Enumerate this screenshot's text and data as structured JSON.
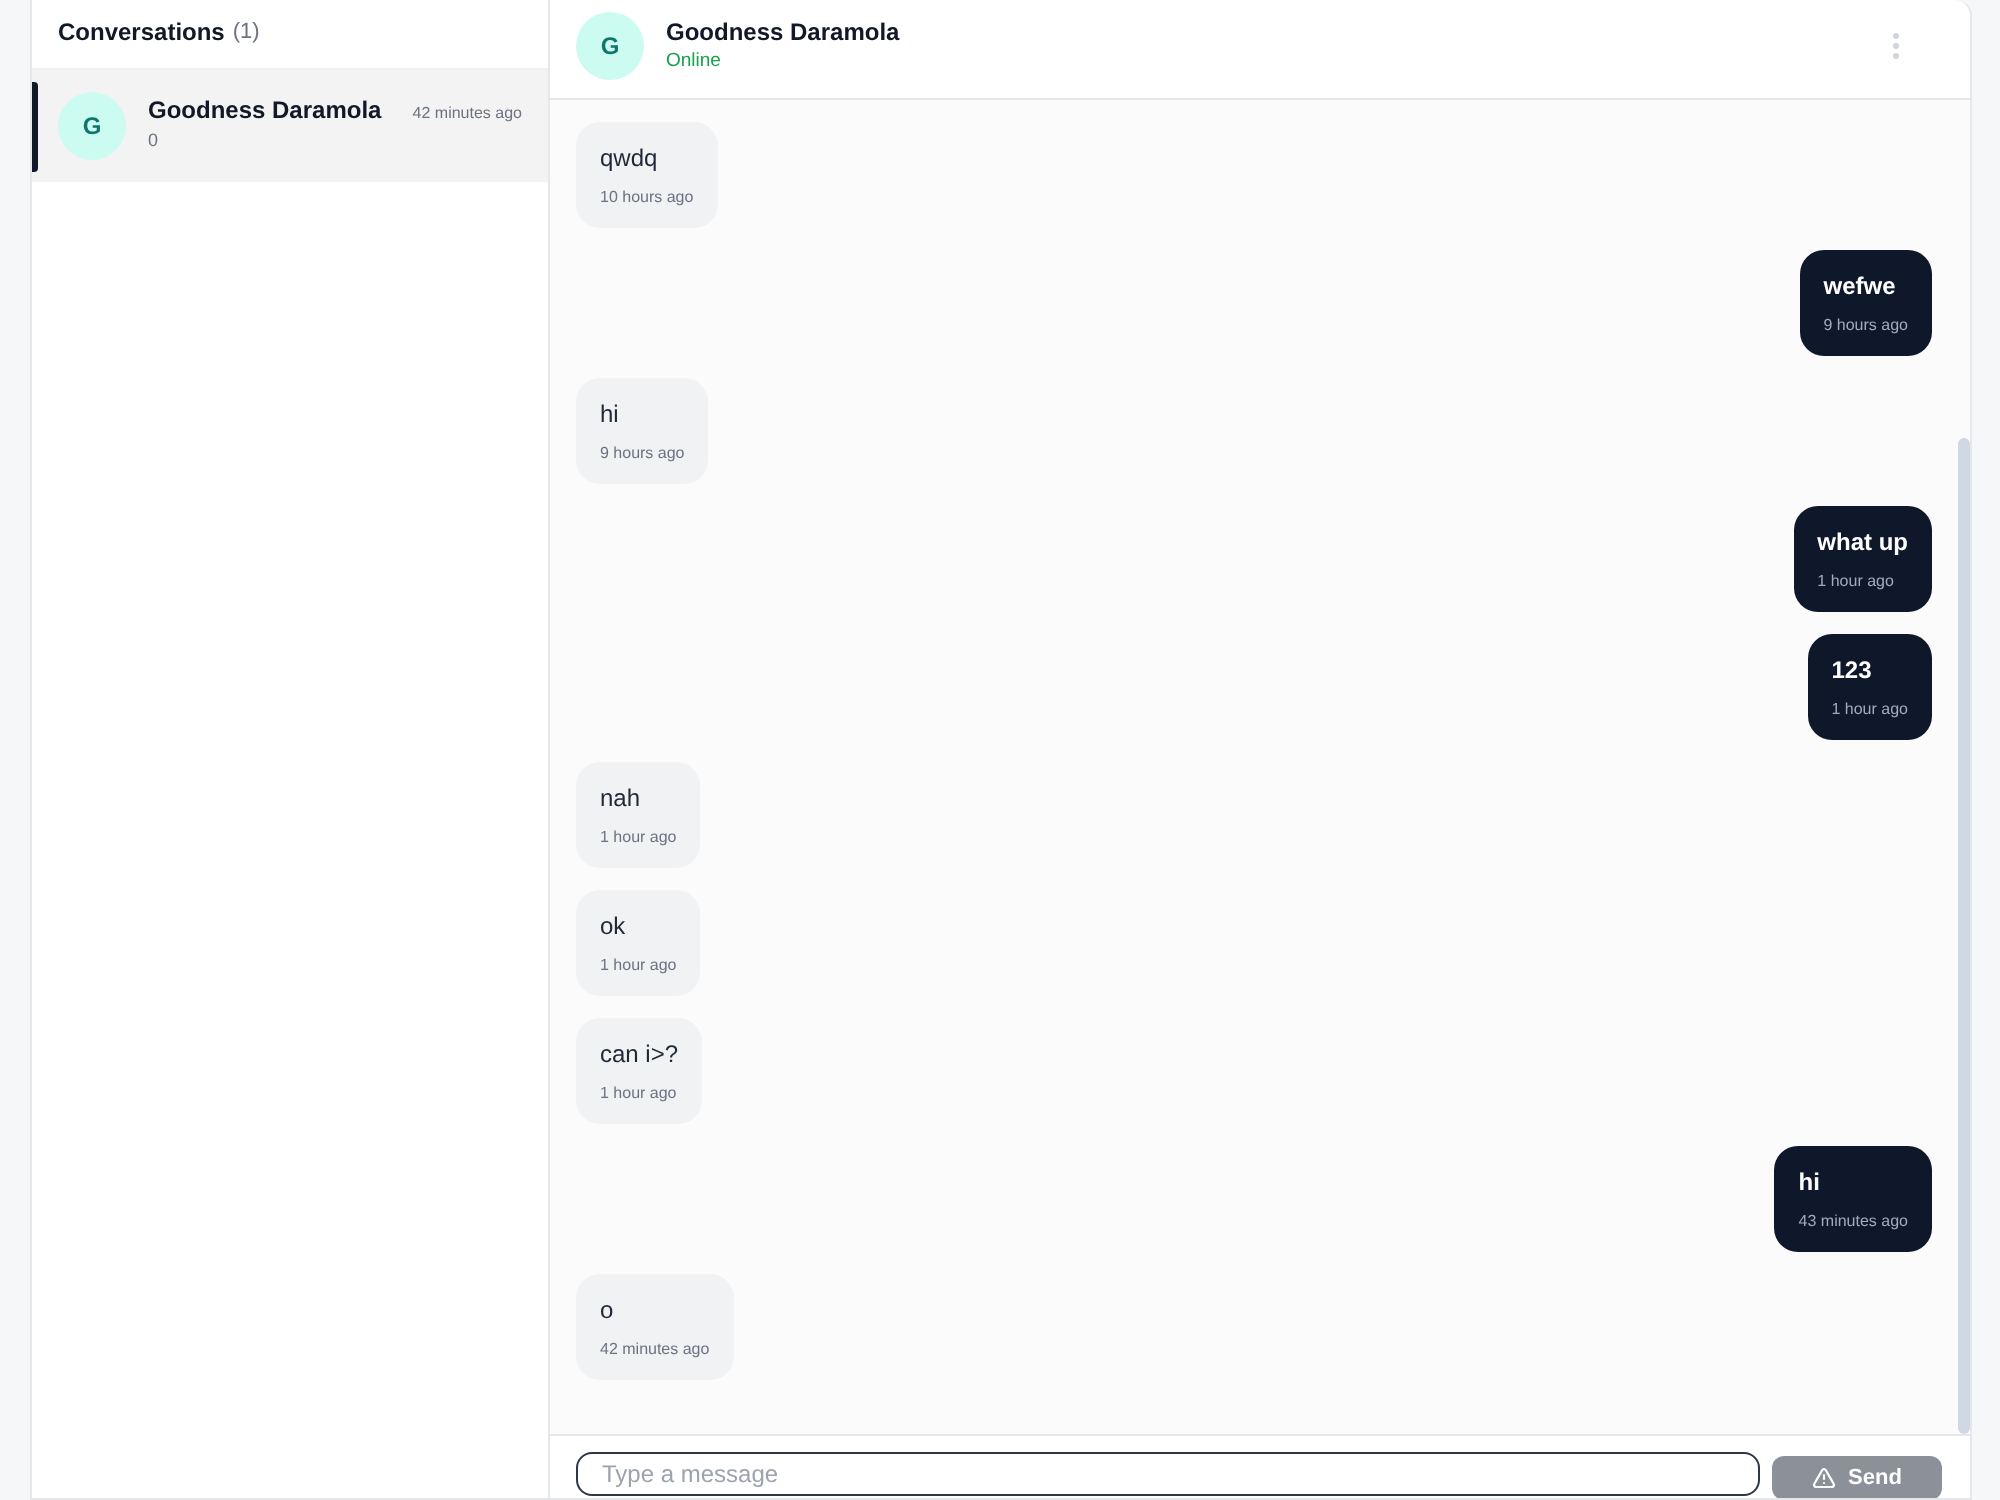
{
  "sidebar": {
    "title": "Conversations",
    "count": "(1)",
    "conversations": [
      {
        "initial": "G",
        "name": "Goodness Daramola",
        "time": "42 minutes ago",
        "preview": "0",
        "selected": true
      }
    ]
  },
  "chat": {
    "contact": {
      "initial": "G",
      "name": "Goodness Daramola",
      "status": "Online"
    },
    "messages": [
      {
        "kind": "received",
        "text": "qwdq",
        "time": "10 hours ago"
      },
      {
        "kind": "sent",
        "text": "wefwe",
        "time": "9 hours ago"
      },
      {
        "kind": "received",
        "text": "hi",
        "time": "9 hours ago"
      },
      {
        "kind": "sent",
        "text": "what up",
        "time": "1 hour ago"
      },
      {
        "kind": "sent",
        "text": "123",
        "time": "1 hour ago"
      },
      {
        "kind": "received",
        "text": "nah",
        "time": "1 hour ago"
      },
      {
        "kind": "received",
        "text": "ok",
        "time": "1 hour ago"
      },
      {
        "kind": "received",
        "text": "can i>?",
        "time": "1 hour ago"
      },
      {
        "kind": "sent",
        "text": "hi",
        "time": "43 minutes ago"
      },
      {
        "kind": "received",
        "text": "o",
        "time": "42 minutes ago"
      }
    ]
  },
  "composer": {
    "placeholder": "Type a message",
    "send": {
      "label": "Send",
      "disabled": true
    }
  }
}
